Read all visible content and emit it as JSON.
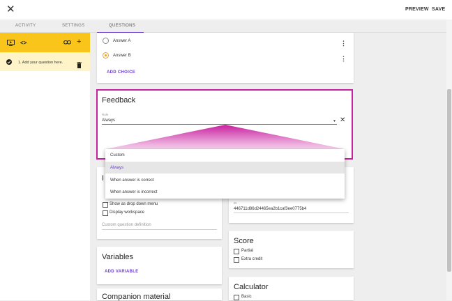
{
  "header": {
    "close_icon": "close-icon",
    "preview_label": "PREVIEW",
    "save_label": "SAVE"
  },
  "tabs": [
    {
      "label": "ACTIVITY"
    },
    {
      "label": "SETTINGS"
    },
    {
      "label": "QUESTIONS",
      "active": true
    }
  ],
  "left_panel": {
    "question_label": "1. Add your question here."
  },
  "choices": {
    "items": [
      {
        "label": "Answer A",
        "selected": false
      },
      {
        "label": "Answer B",
        "selected": true
      }
    ],
    "add_label": "ADD CHOICE"
  },
  "feedback": {
    "title": "Feedback",
    "field_label": "Rule",
    "value": "Always"
  },
  "dropdown": {
    "options": [
      "Custom",
      "Always",
      "When answer is correct",
      "When answer is incorrect"
    ],
    "highlighted_index": 1
  },
  "interaction": {
    "title_partial": "I",
    "show_dropdown_label": "Show as drop down menu",
    "display_workspace_label": "Display workspace",
    "custom_definition_placeholder": "Custom question definition"
  },
  "id_card": {
    "id_label": "ID",
    "id_value": "446711d86d24465ea2b1caf3ee0775b4"
  },
  "score": {
    "title": "Score",
    "partial_label": "Partial",
    "extra_credit_label": "Extra credit"
  },
  "variables": {
    "title": "Variables",
    "add_label": "ADD VARIABLE"
  },
  "calculator": {
    "title": "Calculator",
    "basic_label": "Basic"
  },
  "companion": {
    "title": "Companion material"
  },
  "colors": {
    "accent": "#6b3fd0",
    "highlight": "#c8219f",
    "toolbar": "#f9c51a"
  }
}
